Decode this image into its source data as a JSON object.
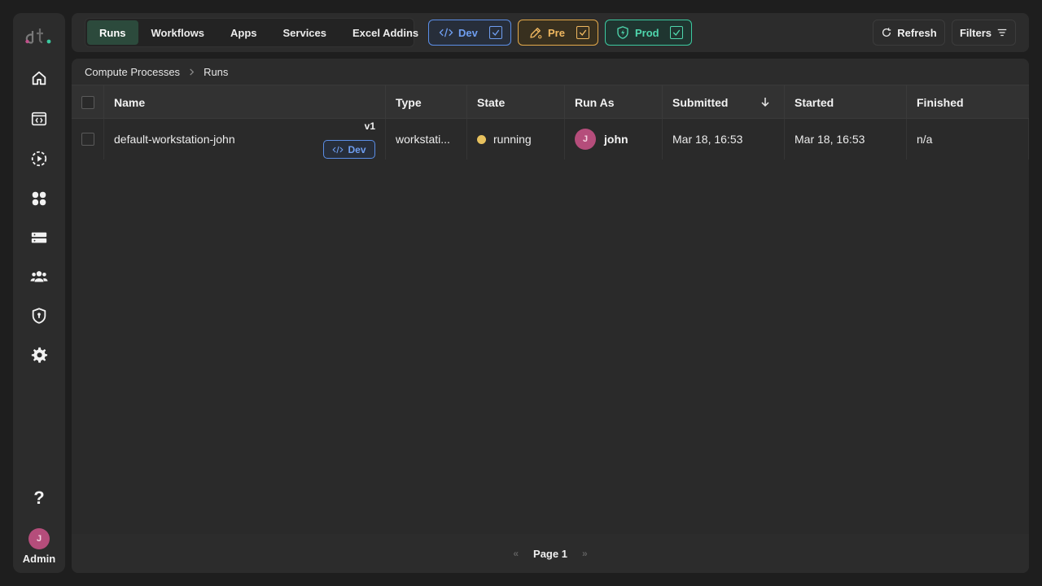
{
  "sidebar": {
    "logo_text": "dt.",
    "items": [
      {
        "name": "home-icon"
      },
      {
        "name": "code-window-icon"
      },
      {
        "name": "play-circle-icon"
      },
      {
        "name": "apps-grid-icon"
      },
      {
        "name": "server-icon"
      },
      {
        "name": "users-icon"
      },
      {
        "name": "shield-lock-icon"
      },
      {
        "name": "gear-icon"
      }
    ],
    "help_label": "?",
    "avatar_initial": "J",
    "user_label": "Admin"
  },
  "topbar": {
    "tabs": [
      "Runs",
      "Workflows",
      "Apps",
      "Services",
      "Excel Addins"
    ],
    "active_tab": "Runs",
    "environments": [
      {
        "label": "Dev",
        "checked": true,
        "color": "#6f9ef0"
      },
      {
        "label": "Pre",
        "checked": true,
        "color": "#f0b860"
      },
      {
        "label": "Prod",
        "checked": true,
        "color": "#4fd6ad"
      }
    ],
    "refresh_label": "Refresh",
    "filters_label": "Filters"
  },
  "breadcrumb": {
    "parent": "Compute Processes",
    "current": "Runs"
  },
  "table": {
    "columns": [
      "Name",
      "Type",
      "State",
      "Run As",
      "Submitted",
      "Started",
      "Finished"
    ],
    "sort_column": "Submitted",
    "sort_direction": "descending",
    "rows": [
      {
        "name": "default-workstation-john",
        "version": "v1",
        "env_badge": "Dev",
        "type": "workstati...",
        "state": "running",
        "state_color": "#e7c15e",
        "run_as_initial": "J",
        "run_as": "john",
        "submitted": "Mar 18, 16:53",
        "started": "Mar 18, 16:53",
        "finished": "n/a"
      }
    ]
  },
  "pager": {
    "prev": "«",
    "label": "Page 1",
    "next": "»"
  }
}
